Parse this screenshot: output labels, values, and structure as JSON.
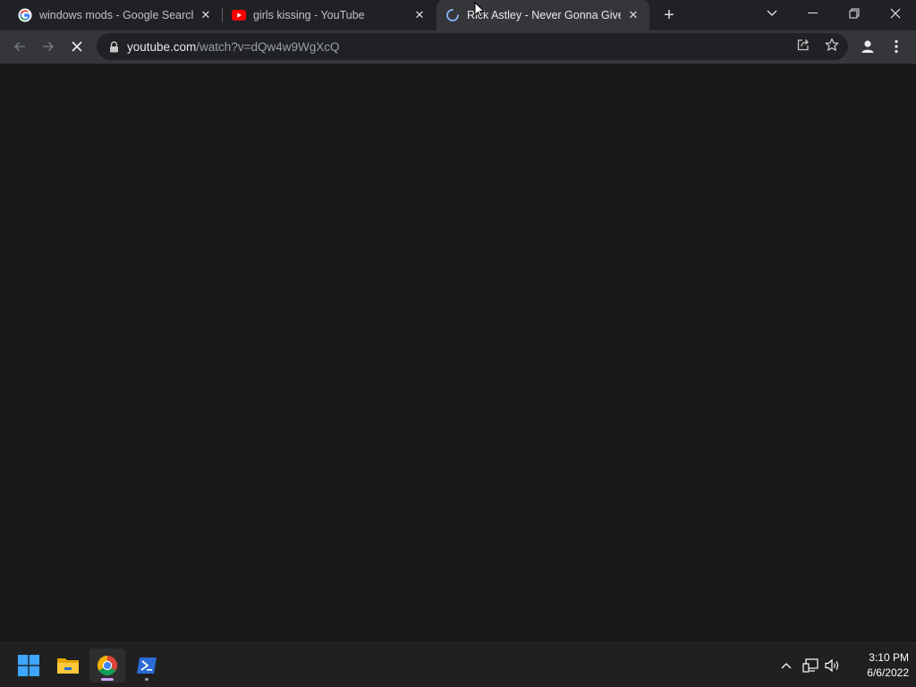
{
  "tabs": [
    {
      "title": "windows mods - Google Search",
      "favicon": "google-g-icon",
      "active": false
    },
    {
      "title": "girls kissing - YouTube",
      "favicon": "youtube-icon",
      "active": false
    },
    {
      "title": "Rick Astley - Never Gonna Give You Up",
      "favicon": "loading-spinner-icon",
      "active": true
    }
  ],
  "address_bar": {
    "host": "youtube.com",
    "path": "/watch?v=dQw4w9WgXcQ"
  },
  "taskbar": {
    "apps": [
      "windows-start-icon",
      "file-explorer-icon",
      "chrome-icon",
      "powershell-icon"
    ],
    "clock": {
      "time": "3:10 PM",
      "date": "6/6/2022"
    }
  },
  "colors": {
    "tabstrip": "#202124",
    "toolbar": "#35363a",
    "content": "#181818",
    "taskbar": "#202020"
  }
}
